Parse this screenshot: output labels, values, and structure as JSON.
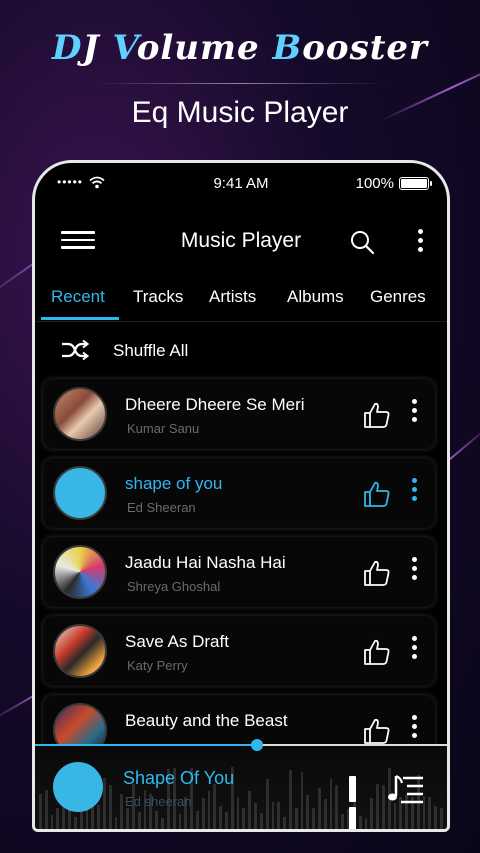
{
  "promo": {
    "title_parts": [
      "D",
      "J ",
      "V",
      "olume ",
      "B",
      "ooster"
    ],
    "subtitle": "Eq Music Player"
  },
  "status_bar": {
    "signal": "•••••",
    "time": "9:41 AM",
    "battery": "100%",
    "battery_level": 1.0
  },
  "app": {
    "title": "Music Player",
    "accent": "#2fb8f0"
  },
  "tabs": [
    {
      "label": "Recent",
      "active": true
    },
    {
      "label": "Tracks",
      "active": false
    },
    {
      "label": "Artists",
      "active": false
    },
    {
      "label": "Albums",
      "active": false
    },
    {
      "label": "Genres",
      "active": false
    }
  ],
  "shuffle": {
    "label": "Shuffle All"
  },
  "songs": [
    {
      "title": "Dheere Dheere Se Meri",
      "artist": "Kumar Sanu",
      "active": false
    },
    {
      "title": "shape of you",
      "artist": "Ed Sheeran",
      "active": true
    },
    {
      "title": "Jaadu Hai Nasha Hai",
      "artist": "Shreya Ghoshal",
      "active": false
    },
    {
      "title": "Save As Draft",
      "artist": "Katy Perry",
      "active": false
    },
    {
      "title": "Beauty and the Beast",
      "artist": "",
      "active": false
    }
  ],
  "now_playing": {
    "title": "Shape Of You",
    "artist": "Ed sheeran",
    "progress": 0.54
  },
  "icons": {
    "menu": "menu-icon",
    "search": "search-icon",
    "more": "more-vertical-icon",
    "shuffle": "shuffle-icon",
    "like": "thumbs-up-icon",
    "pause": "pause-icon",
    "queue": "queue-music-icon"
  }
}
